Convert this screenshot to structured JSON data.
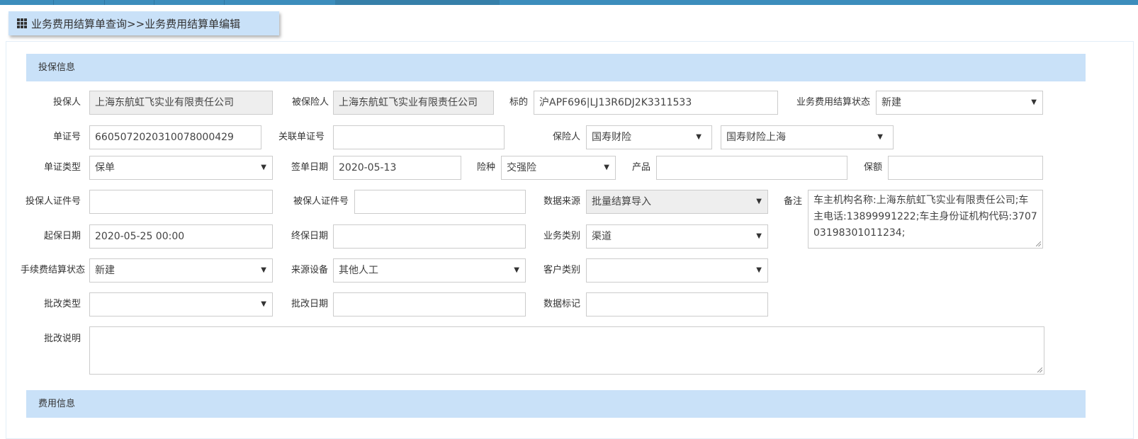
{
  "breadcrumb": "业务费用结算单查询>>业务费用结算单编辑",
  "sections": {
    "policy": "投保信息",
    "fee": "费用信息"
  },
  "fields": {
    "applicant": {
      "label": "投保人",
      "value": "上海东航虹飞实业有限责任公司"
    },
    "insured": {
      "label": "被保险人",
      "value": "上海东航虹飞实业有限责任公司"
    },
    "subject": {
      "label": "标的",
      "value": "沪APF696|LJ13R6DJ2K3311533"
    },
    "settle_status": {
      "label": "业务费用结算状态",
      "value": "新建"
    },
    "doc_no": {
      "label": "单证号",
      "value": "6605072020310078000429"
    },
    "related_doc_no": {
      "label": "关联单证号",
      "value": ""
    },
    "insurer": {
      "label": "保险人",
      "value": "国寿财险",
      "branch": "国寿财险上海"
    },
    "doc_type": {
      "label": "单证类型",
      "value": "保单"
    },
    "sign_date": {
      "label": "签单日期",
      "value": "2020-05-13"
    },
    "risk_type": {
      "label": "险种",
      "value": "交强险"
    },
    "product": {
      "label": "产品",
      "value": ""
    },
    "premium": {
      "label": "保额",
      "value": ""
    },
    "applicant_id": {
      "label": "投保人证件号",
      "value": ""
    },
    "insured_id": {
      "label": "被保人证件号",
      "value": ""
    },
    "data_source": {
      "label": "数据来源",
      "value": "批量结算导入"
    },
    "remark": {
      "label": "备注",
      "value": "车主机构名称:上海东航虹飞实业有限责任公司;车主电话:13899991222;车主身份证机构代码:370703198301011234;"
    },
    "start_date": {
      "label": "起保日期",
      "value": "2020-05-25 00:00"
    },
    "end_date": {
      "label": "终保日期",
      "value": ""
    },
    "biz_category": {
      "label": "业务类别",
      "value": "渠道"
    },
    "fee_status": {
      "label": "手续费结算状态",
      "value": "新建"
    },
    "source_device": {
      "label": "来源设备",
      "value": "其他人工"
    },
    "customer_type": {
      "label": "客户类别",
      "value": ""
    },
    "endorse_type": {
      "label": "批改类型",
      "value": ""
    },
    "endorse_date": {
      "label": "批改日期",
      "value": ""
    },
    "data_mark": {
      "label": "数据标记",
      "value": ""
    },
    "endorse_desc": {
      "label": "批改说明",
      "value": ""
    }
  },
  "arrow": "▼"
}
